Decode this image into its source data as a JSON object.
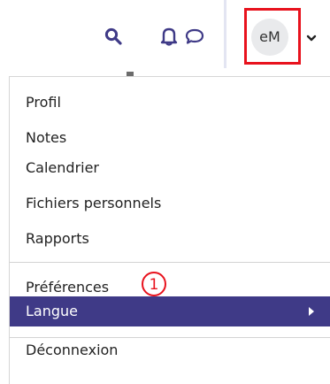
{
  "header": {
    "avatar_initials": "eM",
    "highlight_color": "#e8121d",
    "icons": [
      "search-icon",
      "bell-icon",
      "chat-icon",
      "chevron-down-icon"
    ]
  },
  "menu": {
    "items": [
      {
        "label": "Profil"
      },
      {
        "label": "Notes"
      },
      {
        "label": "Calendrier"
      },
      {
        "label": "Fichiers personnels"
      },
      {
        "label": "Rapports"
      }
    ],
    "preferences_label": "Préférences",
    "language_label": "Langue",
    "logout_label": "Déconnexion",
    "active_color": "#3f3a87",
    "step_marker": "①"
  }
}
